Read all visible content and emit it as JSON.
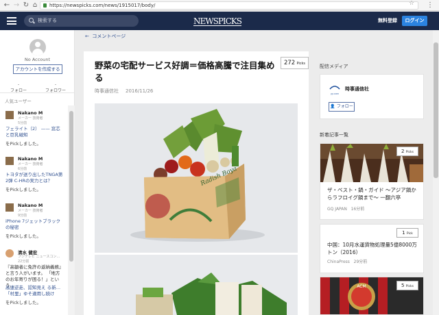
{
  "browser": {
    "url": "https://newspicks.com/news/1915017/body/"
  },
  "header": {
    "search_placeholder": "検索する",
    "logo": "NEWSPICKS",
    "register": "無料登録",
    "login": "ログイン"
  },
  "sidebar": {
    "no_account": "No Account",
    "create_account": "アカウントを作成する",
    "follow_count": "-",
    "follow_label": "フォロー",
    "follower_count": "-",
    "follower_label": "フォロワー",
    "popular_users": "人気ユーザー",
    "feed": [
      {
        "name": "Nakano M",
        "role": "メーカー 技術者",
        "time": "5分前",
        "title": "フェライト（2） —— 窓芯と巨乳磁知",
        "picked": "をPickしました。"
      },
      {
        "name": "Nakano M",
        "role": "メーカー 技術者",
        "time": "6分前",
        "title": "トヨタが送り出したTNGA第2弾 C-HRの実力とは？",
        "picked": "をPickしました。"
      },
      {
        "name": "Nakano M",
        "role": "メーカー 技術者",
        "time": "9分前",
        "title": "iPhone 7ジェットブラックの秘密",
        "picked": "をPickしました。"
      },
      {
        "name": "清水 健宏",
        "role": "フジテレビ ニュースコン…",
        "time": "22分前",
        "comment": "『高額者に免許の返納義務』と言う人がいます。 「地方のお年寄りが困る！」という…",
        "title": "高速逆走、認知見え る新…「村里」ゆそ適用し続け",
        "picked": "をPickしました。"
      }
    ]
  },
  "article": {
    "back": "コメントページ",
    "title": "野菜の宅配サービス好調＝価格高騰で注目集める",
    "picks_count": "272",
    "picks_unit": "Picks",
    "source": "時事通信社",
    "date": "2016/11/26",
    "box_brand": "Radish Boya"
  },
  "rail": {
    "media_label": "配信メディア",
    "media_logo": "JIJI.COM",
    "media_name": "時事通信社",
    "follow": "フォロー",
    "new_label": "新着記事一覧",
    "articles": [
      {
        "picks": "2",
        "unit": "Picks",
        "title": "ザ・ベスト・鍋・ガイド 〜アジア鍋からラフロイグ鍋まで〜 一翻六亭",
        "source": "GQ JAPAN",
        "time": "16分前"
      },
      {
        "picks": "1",
        "unit": "Pick",
        "title": "中国：10月水運貨物処理量5億8000万トン（2016）",
        "source": "ChinaPress",
        "time": "29分前"
      },
      {
        "picks": "5",
        "unit": "Picks",
        "banner": "ACM"
      }
    ]
  }
}
